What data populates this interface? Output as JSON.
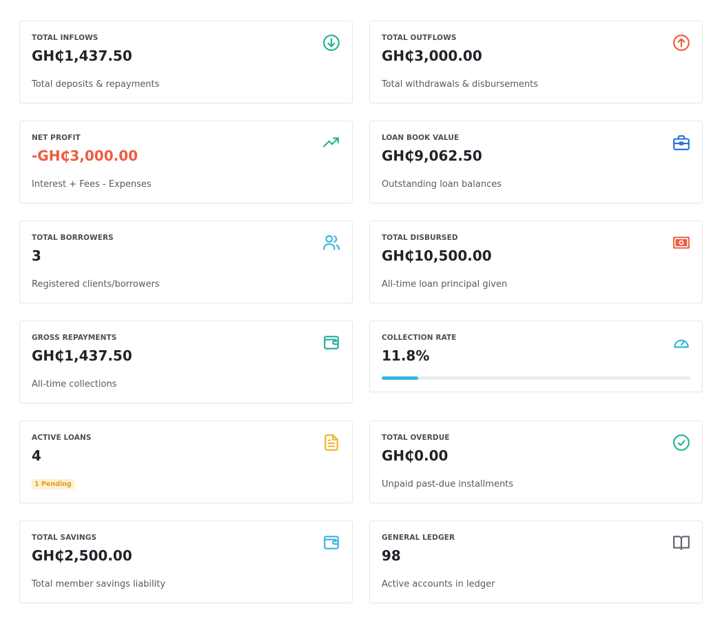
{
  "cards": {
    "inflows": {
      "label": "TOTAL INFLOWS",
      "value": "GH₵1,437.50",
      "desc": "Total deposits & repayments",
      "icon": "arrow-down-circle-icon"
    },
    "outflows": {
      "label": "TOTAL OUTFLOWS",
      "value": "GH₵3,000.00",
      "desc": "Total withdrawals & disbursements",
      "icon": "arrow-up-circle-icon"
    },
    "net_profit": {
      "label": "NET PROFIT",
      "value": "-GH₵3,000.00",
      "desc": "Interest + Fees - Expenses",
      "icon": "trending-up-icon"
    },
    "loan_book": {
      "label": "LOAN BOOK VALUE",
      "value": "GH₵9,062.50",
      "desc": "Outstanding loan balances",
      "icon": "briefcase-icon"
    },
    "borrowers": {
      "label": "TOTAL BORROWERS",
      "value": "3",
      "desc": "Registered clients/borrowers",
      "icon": "users-icon"
    },
    "disbursed": {
      "label": "TOTAL DISBURSED",
      "value": "GH₵10,500.00",
      "desc": "All-time loan principal given",
      "icon": "banknote-icon"
    },
    "repayments": {
      "label": "GROSS REPAYMENTS",
      "value": "GH₵1,437.50",
      "desc": "All-time collections",
      "icon": "wallet-icon"
    },
    "collection_rate": {
      "label": "COLLECTION RATE",
      "value": "11.8%",
      "progress": 0.118,
      "icon": "gauge-icon"
    },
    "active_loans": {
      "label": "ACTIVE LOANS",
      "value": "4",
      "badge": "1 Pending",
      "icon": "document-icon"
    },
    "overdue": {
      "label": "TOTAL OVERDUE",
      "value": "GH₵0.00",
      "desc": "Unpaid past-due installments",
      "icon": "check-circle-icon"
    },
    "savings": {
      "label": "TOTAL SAVINGS",
      "value": "GH₵2,500.00",
      "desc": "Total member savings liability",
      "icon": "wallet-icon"
    },
    "ledger": {
      "label": "GENERAL LEDGER",
      "value": "98",
      "desc": "Active accounts in ledger",
      "icon": "book-open-icon"
    }
  },
  "colors": {
    "green": "#1fb58f",
    "red": "#ef5b3f",
    "blue": "#2f6fd6",
    "cyan": "#35b6e0",
    "teal": "#1fae9a",
    "amber": "#f0b429",
    "gray": "#5f6670"
  }
}
